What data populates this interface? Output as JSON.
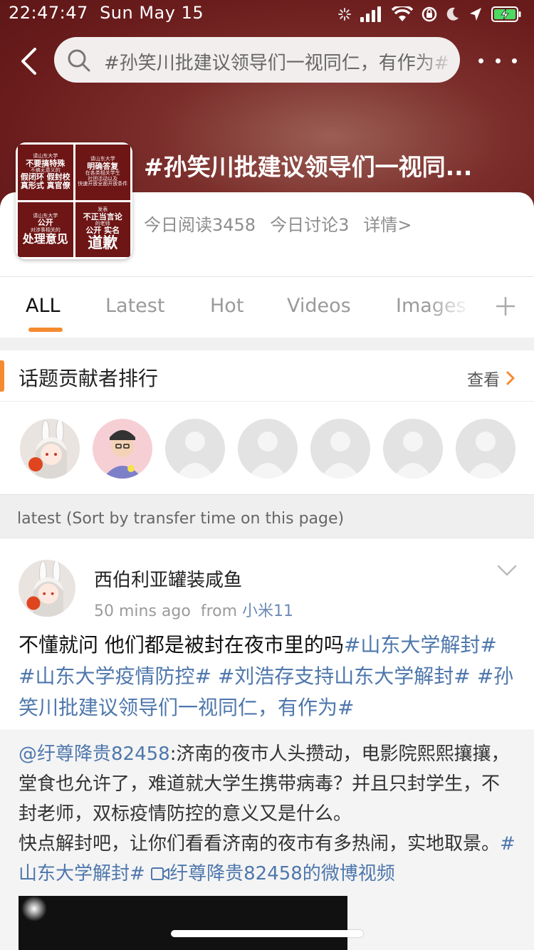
{
  "status_bar": {
    "time": "22:47:47",
    "date": "Sun May 15"
  },
  "search": {
    "query": "#孙笑川批建议领导们一视同仁，有作为#"
  },
  "topic": {
    "title": "#孙笑川批建议领导们一视同...",
    "reads": "今日阅读3458",
    "discussions": "今日讨论3",
    "details": "详情>",
    "cover": {
      "tl_small": "请山东大学",
      "tl_line1": "不要搞特殊",
      "tl_line2": "不搞无意义的",
      "tl_line3": "假闭环 假封校",
      "tl_line4": "真形式 真官僚",
      "tr_small": "请山东大学",
      "tr_line1": "明确答复",
      "tr_line2": "在各类相关学生",
      "tr_line3": "社团活动以及",
      "tr_line4": "快速开放全面开放条件",
      "bl_small": "请山东大学",
      "bl_line1": "公开",
      "bl_line2": "对涉事相关的",
      "bl_line3": "处理意见",
      "br_small": "发表",
      "br_line1": "不正当言论",
      "br_line2": "的老师",
      "br_line3": "公开 实名",
      "br_line4": "道歉"
    }
  },
  "tabs": [
    {
      "label": "ALL",
      "active": true
    },
    {
      "label": "Latest"
    },
    {
      "label": "Hot"
    },
    {
      "label": "Videos"
    },
    {
      "label": "Images"
    }
  ],
  "contributors": {
    "title": "话题贡献者排行",
    "view_more": "查看"
  },
  "latest_bar": "latest (Sort by transfer time on this page)",
  "post": {
    "username": "西伯利亚罐装咸鱼",
    "time": "50 mins ago",
    "from_label": "from",
    "source": "小米11",
    "text_plain": "不懂就问  他们都是被封在夜市里的吗",
    "tag1": "#山东大学解封#",
    "tag2": "#山东大学疫情防控#",
    "tag3": "#刘浩存支持山东大学解封#",
    "tag4": "#孙笑川批建议领导们一视同仁，有作为#",
    "repost_user": "@纡尊降贵82458",
    "repost_text": ":济南的夜市人头攒动，电影院熙熙攘攘，堂食也允许了，难道就大学生携带病毒？并且只封学生，不封老师，双标疫情防控的意义又是什么。",
    "repost_text2": "快点解封吧，让你们看看济南的夜市有多热闹，实地取景。",
    "repost_tag": "#山东大学解封#",
    "repost_video": "纡尊降贵82458的微博视频"
  },
  "colors": {
    "accent": "#f58b2f",
    "link": "#4e77ac",
    "hero": "#6a1c1c"
  }
}
